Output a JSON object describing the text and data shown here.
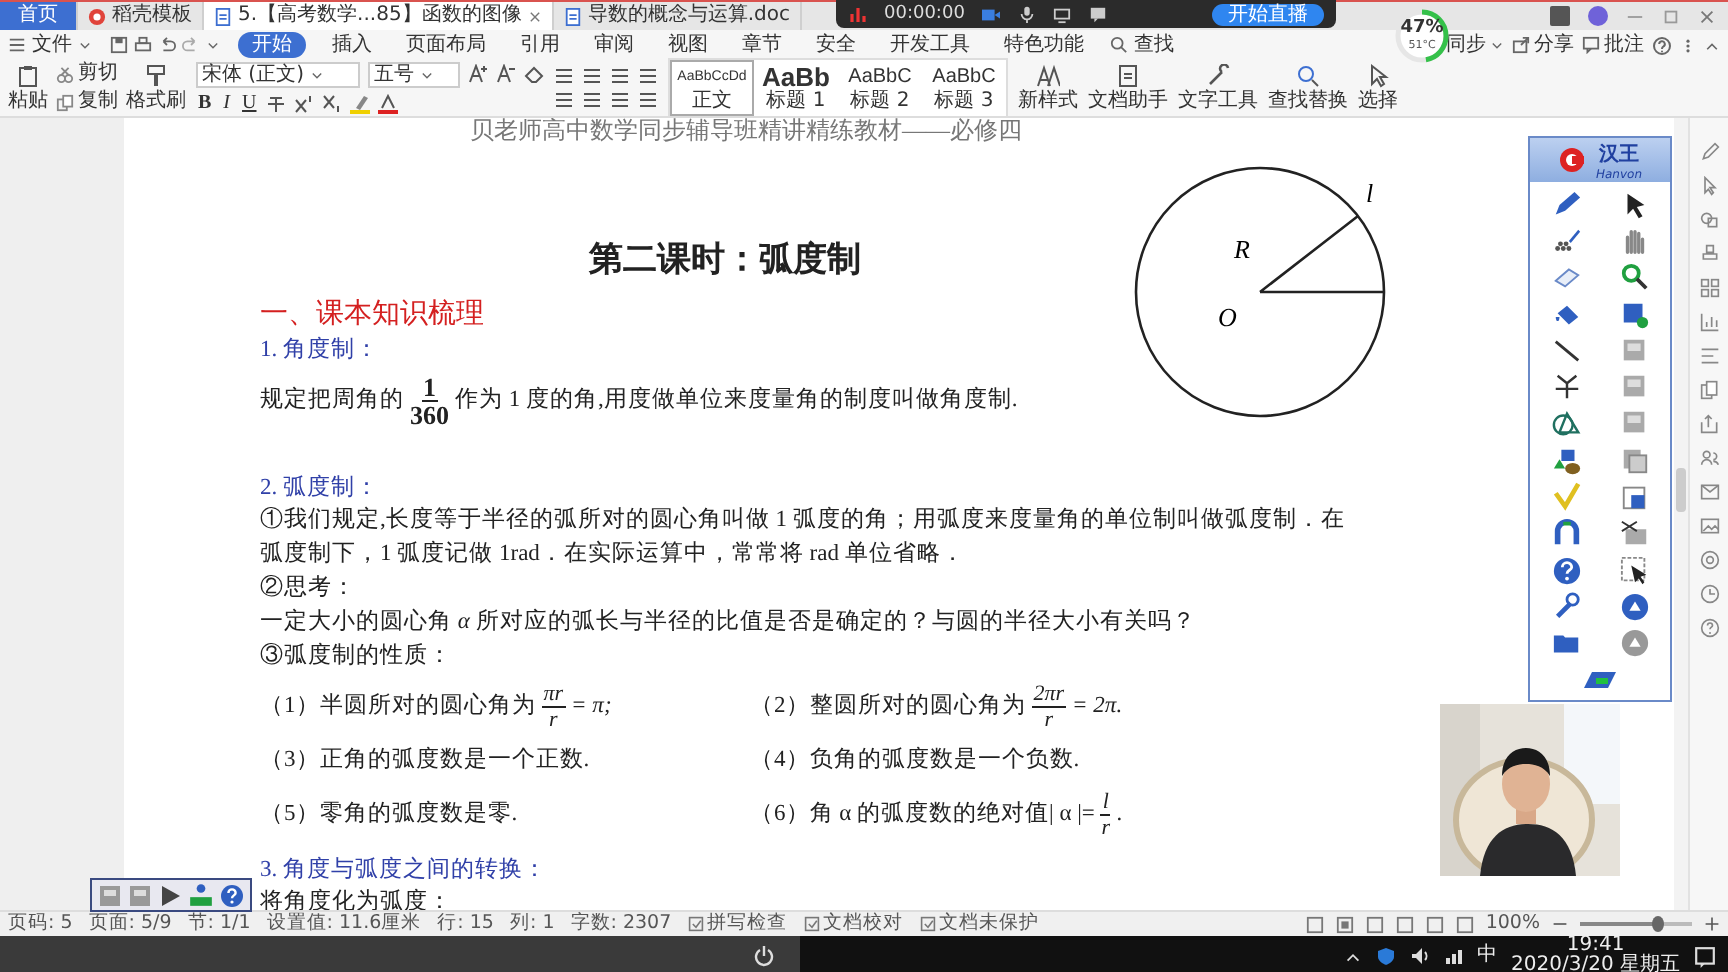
{
  "tabs": [
    {
      "label": "首页",
      "kind": "home",
      "selected": false
    },
    {
      "label": "稻壳模板",
      "kind": "template",
      "selected": false
    },
    {
      "label": "5.【高考数学...85】函数的图像",
      "kind": "document",
      "selected": true
    },
    {
      "label": "导数的概念与运算.doc",
      "kind": "document",
      "selected": false
    }
  ],
  "recorder": {
    "timer": "00:00:00",
    "start_button": "开始直播"
  },
  "menu": {
    "file": "文件",
    "items": [
      {
        "label": "开始",
        "selected": true
      },
      {
        "label": "插入",
        "selected": false
      },
      {
        "label": "页面布局",
        "selected": false
      },
      {
        "label": "引用",
        "selected": false
      },
      {
        "label": "审阅",
        "selected": false
      },
      {
        "label": "视图",
        "selected": false
      },
      {
        "label": "章节",
        "selected": false
      },
      {
        "label": "安全",
        "selected": false
      },
      {
        "label": "开发工具",
        "selected": false
      },
      {
        "label": "特色功能",
        "selected": false
      }
    ],
    "search": "查找",
    "sync": "同步",
    "share": "分享",
    "comment": "批注"
  },
  "ribbon": {
    "paste": "粘贴",
    "cut": "剪切",
    "copy": "复制",
    "format_painter": "格式刷",
    "font": "宋体 (正文)",
    "size": "五号",
    "format_buttons": [
      "B",
      "I",
      "U"
    ],
    "styles": [
      {
        "sample": "AaBbCcDd",
        "name": "正文",
        "selected": true
      },
      {
        "sample": "AaBb",
        "name": "标题 1",
        "selected": false
      },
      {
        "sample": "AaBbC",
        "name": "标题 2",
        "selected": false
      },
      {
        "sample": "AaBbC",
        "name": "标题 3",
        "selected": false
      }
    ],
    "tools": [
      "新样式",
      "文档助手",
      "文字工具",
      "查找替换",
      "选择"
    ]
  },
  "gauge": {
    "percent": "47%",
    "temperature": "51°C",
    "level": 0.47
  },
  "document": {
    "header": "贝老师高中数学同步辅导班精讲精练教材——必修四",
    "title": "第二课时：弧度制",
    "section": "一、课本知识梳理",
    "diagram": {
      "radius_label": "R",
      "arc_label": "l",
      "center_label": "O"
    },
    "blocks": [
      {
        "kind": "subheading",
        "text": "1. 角度制："
      },
      {
        "kind": "fraction_line",
        "before": "规定把周角的",
        "num": "1",
        "den": "360",
        "after": "作为 1 度的角,用度做单位来度量角的制度叫做角度制."
      },
      {
        "kind": "subheading",
        "text": "2. 弧度制："
      },
      {
        "kind": "text",
        "text": "①我们规定,长度等于半径的弧所对的圆心角叫做 1 弧度的角；用弧度来度量角的单位制叫做弧度制．在"
      },
      {
        "kind": "text",
        "text": "弧度制下，1 弧度记做 1rad．在实际运算中，常常将 rad 单位省略．"
      },
      {
        "kind": "text",
        "text": "②思考："
      },
      {
        "kind": "text",
        "text": "一定大小的圆心角 *α* 所对应的弧长与半径的比值是否是确定的？与圆的半径大小有关吗？"
      },
      {
        "kind": "text",
        "text": "③弧度制的性质："
      },
      {
        "kind": "properties",
        "items": [
          {
            "kind": "fraction",
            "text": "（1）半圆所对的圆心角为",
            "num": "πr",
            "den": "r",
            "tail": "= π;"
          },
          {
            "kind": "fraction",
            "text": "（2）整圆所对的圆心角为",
            "num": "2πr",
            "den": "r",
            "tail": "= 2π."
          },
          {
            "kind": "plain",
            "text": "（3）正角的弧度数是一个正数."
          },
          {
            "kind": "plain",
            "text": "（4）负角的弧度数是一个负数."
          },
          {
            "kind": "plain",
            "text": "（5）零角的弧度数是零."
          },
          {
            "kind": "fraction",
            "text": "（6）角 α 的弧度数的绝对值| α |=",
            "num": "l",
            "den": "r",
            "tail": "."
          }
        ]
      },
      {
        "kind": "subheading",
        "text": "3.  角度与弧度之间的转换："
      },
      {
        "kind": "text",
        "text": "将角度化为弧度："
      }
    ]
  },
  "toolbar": {
    "name": "汉王",
    "brand": "Hanvon"
  },
  "status": {
    "items": [
      "页码: 5",
      "页面: 5/9",
      "节: 1/1",
      "设置值: 11.6厘米",
      "行: 15",
      "列: 1",
      "字数: 2307"
    ],
    "checks": [
      "拼写检查",
      "文档校对",
      "文档未保护"
    ],
    "zoom": "100%",
    "zoom_slider": {
      "level": 0.7
    }
  },
  "taskbar": {
    "time": "19:41",
    "date": "2020/3/20 星期五",
    "ime": "中"
  }
}
